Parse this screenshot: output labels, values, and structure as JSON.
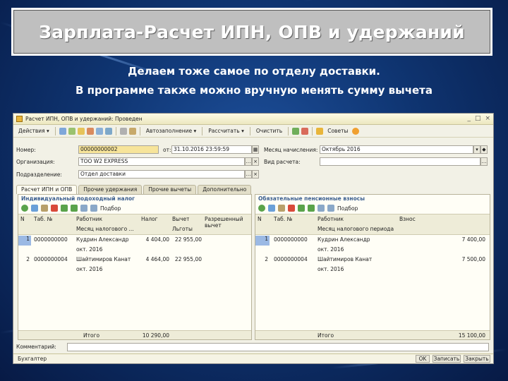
{
  "slide": {
    "title": "Зарплата-Расчет ИПН, ОПВ и удержаний",
    "subtitle_1": "Делаем тоже самое по отделу доставки.",
    "subtitle_2": "В программе также можно вручную менять сумму вычета"
  },
  "window": {
    "title": "Расчет ИПН, ОПВ и удержаний: Проведен",
    "controls": [
      "_",
      "□",
      "×"
    ]
  },
  "toolbar": {
    "actions": "Действия",
    "autofill": "Автозаполнение",
    "calculate": "Рассчитать",
    "clear": "Очистить",
    "tips": "Советы"
  },
  "form": {
    "number_label": "Номер:",
    "number_value": "00000000002",
    "from_label": "от:",
    "date_value": "31.10.2016 23:59:59",
    "month_label": "Месяц начисления:",
    "month_value": "Октябрь 2016",
    "org_label": "Организация:",
    "org_value": "ТОО W2 EXPRESS",
    "calc_type_label": "Вид расчета:",
    "calc_type_value": "",
    "division_label": "Подразделение:",
    "division_value": "Отдел доставки"
  },
  "tabs": [
    "Расчет ИПН и ОПВ",
    "Прочие удержания",
    "Прочие вычеты",
    "Дополнительно"
  ],
  "ipn": {
    "title": "Индивидуальный подоходный налог",
    "pick_label": "Подбор",
    "headers": {
      "n": "N",
      "tab": "Таб. №",
      "worker": "Работник",
      "month": "Месяц налогового ...",
      "tax": "Налог",
      "deduction": "Вычет",
      "benefits": "Льготы",
      "allowed": "Разрешенный вычет"
    },
    "rows": [
      {
        "n": "1",
        "tab": "0000000000",
        "worker": "Кудрин Александр",
        "month": "окт. 2016",
        "tax": "4 404,00",
        "deduction": "22 955,00"
      },
      {
        "n": "2",
        "tab": "0000000004",
        "worker": "Шайтимиров Канат",
        "month": "окт. 2016",
        "tax": "4 464,00",
        "deduction": "22 955,00"
      }
    ],
    "total_label": "Итого",
    "total_value": "10 290,00"
  },
  "opv": {
    "title": "Обязательные пенсионные взносы",
    "pick_label": "Подбор",
    "headers": {
      "n": "N",
      "tab": "Таб. №",
      "worker": "Работник",
      "month": "Месяц налогового периода",
      "contribution": "Взнос"
    },
    "rows": [
      {
        "n": "1",
        "tab": "0000000000",
        "worker": "Кудрин Александр",
        "month": "окт. 2016",
        "contribution": "7 400,00"
      },
      {
        "n": "2",
        "tab": "0000000004",
        "worker": "Шайтимиров Канат",
        "month": "окт. 2016",
        "contribution": "7 500,00"
      }
    ],
    "total_label": "Итого",
    "total_value": "15 100,00"
  },
  "comment_label": "Комментарий:",
  "status": {
    "accountant": "Бухгалтер",
    "ok": "OK",
    "save": "Записать",
    "close": "Закрыть"
  }
}
